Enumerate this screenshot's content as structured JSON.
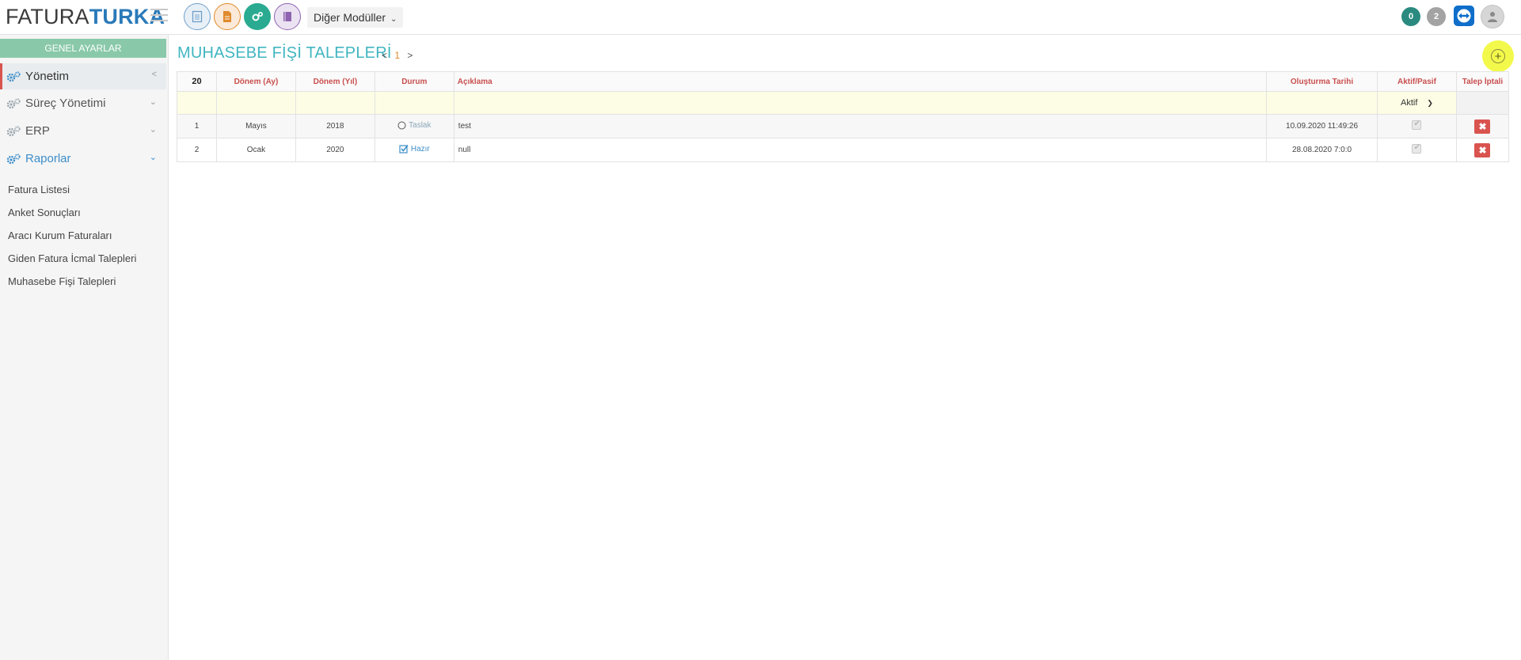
{
  "app": {
    "logo_part1": "FATURA",
    "logo_part2": "TURKA",
    "modules_dropdown": "Diğer Modüller",
    "badge_count_1": "0",
    "badge_count_2": "2"
  },
  "sidebar": {
    "header": "GENEL AYARLAR",
    "menu": [
      {
        "label": "Yönetim",
        "icon": "gears-icon",
        "arrow": "chevron-left-icon"
      },
      {
        "label": "Süreç Yönetimi",
        "icon": "gears-icon",
        "arrow": "chevron-down-icon"
      },
      {
        "label": "ERP",
        "icon": "gears-icon",
        "arrow": "chevron-down-icon"
      },
      {
        "label": "Raporlar",
        "icon": "gears-icon",
        "arrow": "chevron-down-icon"
      }
    ],
    "submenu": [
      {
        "label": "Fatura Listesi"
      },
      {
        "label": "Anket Sonuçları"
      },
      {
        "label": "Aracı Kurum Faturaları"
      },
      {
        "label": "Giden Fatura İcmal Talepleri"
      },
      {
        "label": "Muhasebe Fişi Talepleri"
      }
    ]
  },
  "page": {
    "title": "MUHASEBE FİŞİ TALEPLERİ",
    "pager_prev": "<",
    "pager_current": "1",
    "pager_next": ">",
    "add_button_label": "+"
  },
  "table": {
    "page_size": "20",
    "columns": [
      "Dönem (Ay)",
      "Dönem (Yıl)",
      "Durum",
      "Açıklama",
      "Oluşturma Tarihi",
      "Aktif/Pasif",
      "Talep İptali"
    ],
    "filter_aktif_pasif": "Aktif",
    "rows": [
      {
        "no": "1",
        "ay": "Mayıs",
        "yil": "2018",
        "durum": "Taslak",
        "durum_icon": "radio-circle-icon",
        "aciklama": "test",
        "tarih": "10.09.2020 11:49:26",
        "aktif": true
      },
      {
        "no": "2",
        "ay": "Ocak",
        "yil": "2020",
        "durum": "Hazır",
        "durum_icon": "checked-box-icon",
        "aciklama": "null",
        "tarih": "28.08.2020 7:0:0",
        "aktif": true
      }
    ]
  },
  "colors": {
    "title": "#41b6c1",
    "header_text": "#c94f4f",
    "sidebar_header": "#89c9a9",
    "highlight": "#f3f94a",
    "cancel_button": "#d9534f",
    "active_link": "#3d8ec9",
    "draft_status": "#8aa6b8",
    "ready_status": "#3d8ec9"
  }
}
